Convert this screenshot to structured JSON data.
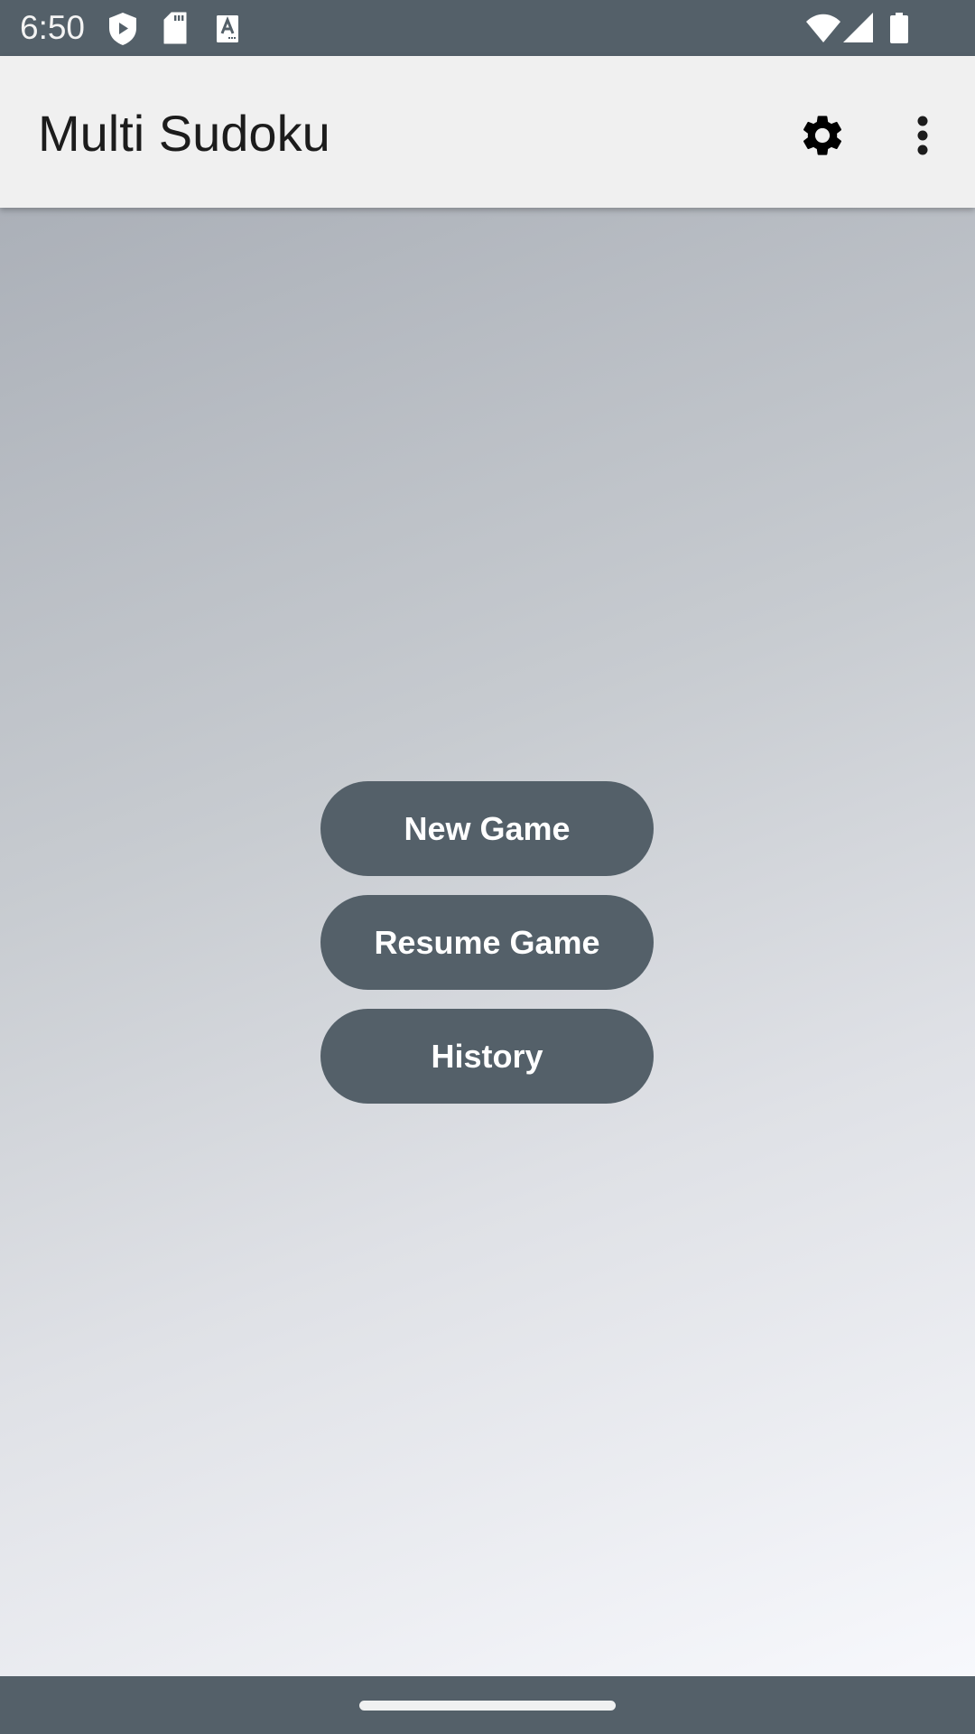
{
  "status_bar": {
    "time": "6:50",
    "left_icons": [
      "play-protect-shield-icon",
      "sd-card-icon",
      "font-a-icon"
    ],
    "right_icons": [
      "wifi-icon",
      "cellular-signal-icon",
      "battery-icon"
    ]
  },
  "app_bar": {
    "title": "Multi Sudoku",
    "actions": [
      {
        "name": "settings",
        "icon": "gear-icon"
      },
      {
        "name": "more-options",
        "icon": "more-vert-icon"
      }
    ]
  },
  "main_menu": {
    "buttons": [
      {
        "label": "New Game"
      },
      {
        "label": "Resume Game"
      },
      {
        "label": "History"
      }
    ]
  },
  "colors": {
    "bar": "#546069",
    "app_bar_bg": "#f0f0f0",
    "button_bg": "#546069",
    "button_text": "#ffffff",
    "title_text": "#1c1c1c"
  }
}
